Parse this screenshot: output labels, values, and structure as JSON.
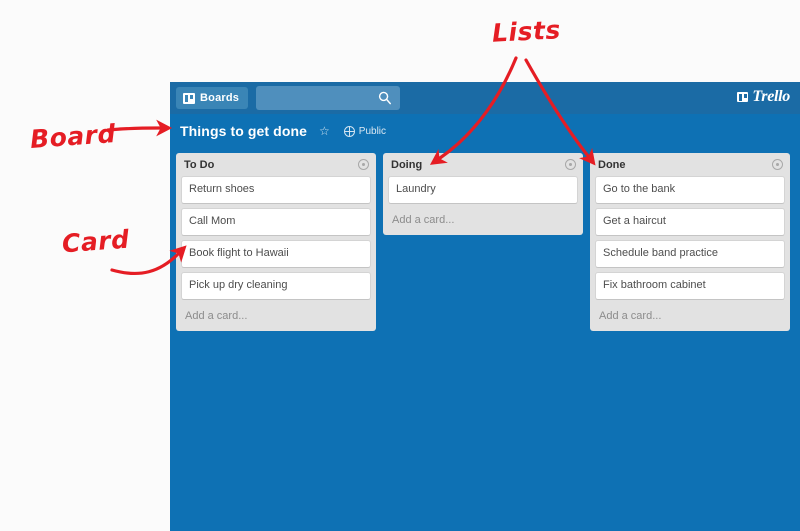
{
  "app": {
    "name": "Trello",
    "background_color": "#0e71b4",
    "nav_color": "#1b6ba5"
  },
  "top_nav": {
    "boards_button_label": "Boards",
    "boards_icon": "board-icon",
    "search": {
      "value": "",
      "placeholder": "",
      "icon": "search-icon"
    },
    "logo": {
      "icon": "board-icon",
      "wordmark": "Trello"
    }
  },
  "board_header": {
    "title": "Things to get done",
    "star_icon": "star-icon",
    "visibility_icon": "globe-icon",
    "visibility_label": "Public"
  },
  "lists": [
    {
      "title": "To Do",
      "menu_icon": "list-menu-icon",
      "cards": [
        {
          "text": "Return shoes"
        },
        {
          "text": "Call Mom"
        },
        {
          "text": "Book flight to Hawaii"
        },
        {
          "text": "Pick up dry cleaning"
        }
      ],
      "add_card_label": "Add a card..."
    },
    {
      "title": "Doing",
      "menu_icon": "list-menu-icon",
      "cards": [
        {
          "text": "Laundry"
        }
      ],
      "add_card_label": "Add a card..."
    },
    {
      "title": "Done",
      "menu_icon": "list-menu-icon",
      "cards": [
        {
          "text": "Go to the bank"
        },
        {
          "text": "Get a haircut"
        },
        {
          "text": "Schedule band practice"
        },
        {
          "text": "Fix bathroom cabinet"
        }
      ],
      "add_card_label": "Add a card..."
    }
  ],
  "annotations": {
    "color": "#e51d24",
    "items": [
      {
        "label": "Board",
        "points_to": "board-header"
      },
      {
        "label": "Card",
        "points_to": "card"
      },
      {
        "label": "Lists",
        "points_to": "list-headers"
      }
    ]
  }
}
